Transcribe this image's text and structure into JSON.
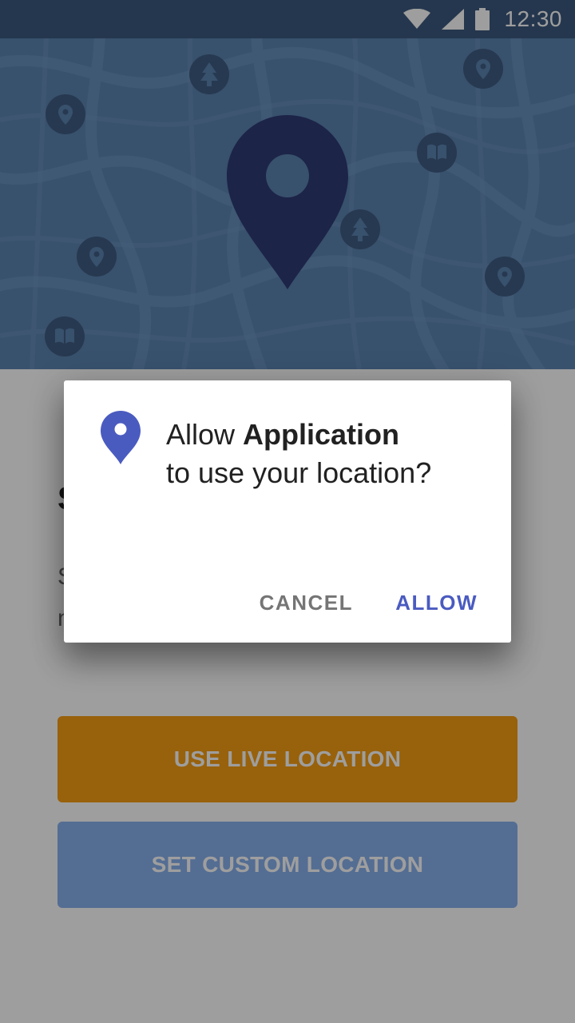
{
  "status_bar": {
    "time": "12:30",
    "icons": [
      "wifi-icon",
      "cell-signal-icon",
      "battery-icon"
    ]
  },
  "hero": {
    "icons": [
      "pin-icon",
      "tree-icon",
      "book-icon"
    ],
    "main_pin_color": "#2e3a73"
  },
  "content": {
    "title": "S",
    "description": "S\nn"
  },
  "buttons": {
    "live_location": "USE LIVE LOCATION",
    "custom_location": "SET CUSTOM LOCATION"
  },
  "dialog": {
    "message_prefix": "Allow ",
    "app_name": "Application",
    "message_suffix": "to use your location?",
    "cancel_label": "CANCEL",
    "allow_label": "ALLOW",
    "accent_color": "#4a5bc0"
  },
  "colors": {
    "status_bar": "#3d5a7e",
    "hero_background": "#5b83b0",
    "live_button": "#f59d12",
    "custom_button": "#88b0ee"
  }
}
